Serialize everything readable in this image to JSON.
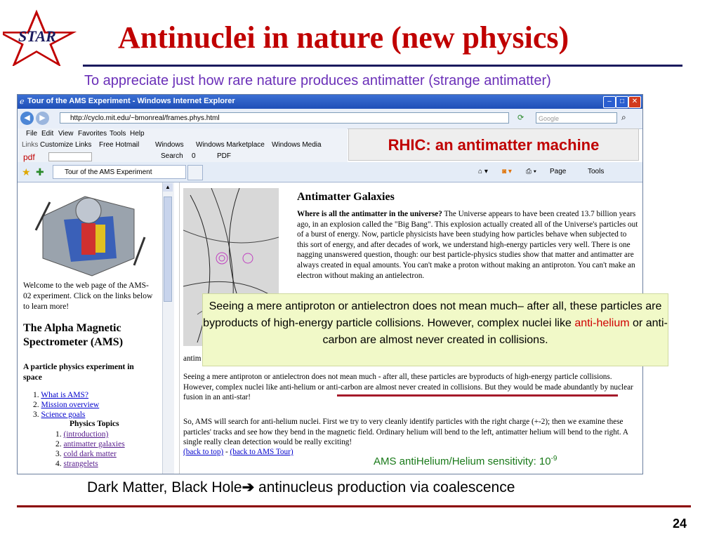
{
  "slide": {
    "logo_text": "STAR",
    "title": "Antinuclei in nature (new physics)",
    "subtitle": "To appreciate just how rare nature produces antimatter (strange antimatter)",
    "bottom_text_prefix": "Dark Matter, Black Hole",
    "bottom_arrow": "➔",
    "bottom_text_suffix": " antinucleus production via coalescence",
    "page_number": "24"
  },
  "browser": {
    "window_title": "Tour of the AMS Experiment - Windows Internet Explorer",
    "address": "http://cyclo.mit.edu/~bmonreal/frames.phys.html",
    "search_placeholder": "Google",
    "menu": [
      "File",
      "Edit",
      "View",
      "Favorites",
      "Tools",
      "Help"
    ],
    "links_label": "Links",
    "links": [
      "Customize Links",
      "Free Hotmail",
      "Windows",
      "Windows Marketplace",
      "Windows Media"
    ],
    "pdf_label": "pdf",
    "pdf_search": "Search",
    "pdf_count": "0",
    "pdf_pdf": "PDF",
    "tab_title": "Tour of the AMS Experiment",
    "cmd_page": "Page",
    "cmd_tools": "Tools"
  },
  "callouts": {
    "rhic": "RHIC: an antimatter machine",
    "green_part1": "Seeing a mere antiproton or antielectron does not mean much– after all, these particles are byproducts of high-energy particle collisions. However, complex nuclei like ",
    "green_highlight": "anti-helium",
    "green_part2": " or anti-carbon are almost never created in collisions.",
    "sensitivity_prefix": "AMS antiHelium/Helium sensitivity: 10",
    "sensitivity_exp": "-9"
  },
  "left_pane": {
    "welcome": "Welcome to the web page of the AMS-02 experiment. Click on the links below to learn more!",
    "heading": "The Alpha Magnetic Spectrometer (AMS)",
    "subheading": "A particle physics experiment in space",
    "nav": [
      {
        "num": "1.",
        "label": "What is AMS?"
      },
      {
        "num": "2.",
        "label": "Mission overview"
      },
      {
        "num": "3.",
        "label": "Science goals"
      }
    ],
    "topics_title": "Physics Topics",
    "topics": [
      {
        "num": "1.",
        "label": "(introduction)"
      },
      {
        "num": "2.",
        "label": "antimatter galaxies"
      },
      {
        "num": "3.",
        "label": "cold dark matter"
      },
      {
        "num": "4.",
        "label": "strangelets"
      }
    ]
  },
  "right_pane": {
    "heading": "Antimatter Galaxies",
    "para1_bold": "Where is all the antimatter in the universe?",
    "para1": " The Universe appears to have been created 13.7 billion years ago, in an explosion called the \"Big Bang\". This explosion actually created all of the Universe's particles out of a burst of energy. Now, particle physicists have been studying how particles behave when subjected to this sort of energy, and after decades of work, we understand high-energy particles very well. There is one nagging unanswered question, though: our best particle-physics studies show that matter and antimatter are always created in equal amounts. You can't make a proton without making an antiproton. You can't make an electron without making an antielectron.",
    "caption_fragment": "antim",
    "para2": "Seeing a mere antiproton or antielectron does not mean much - after all, these particles are byproducts of high-energy particle collisions. However, complex nuclei like anti-helium or anti-carbon are almost never created in collisions. But they would be made abundantly by nuclear fusion in an anti-star!",
    "para3": "So, AMS will search for anti-helium nuclei. First we try to very cleanly identify particles with the right charge (+-2); then we examine these particles' tracks and see how they bend in the magnetic field. Ordinary helium will bend to the left, antimatter helium will bend to the right. A single really clean detection would be really exciting!",
    "back_top": "(back to top)",
    "separator": " - ",
    "back_tour": "(back to AMS Tour)"
  }
}
